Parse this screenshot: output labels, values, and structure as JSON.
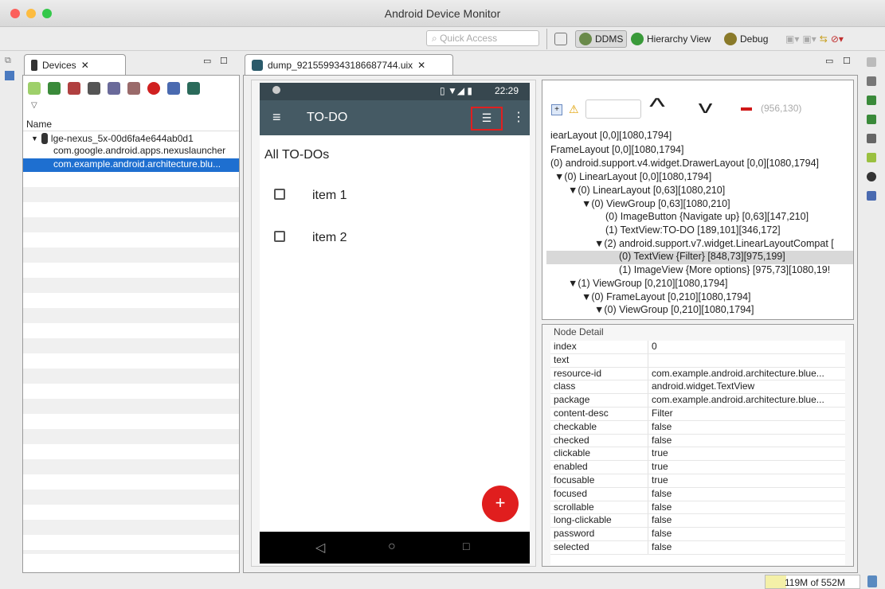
{
  "window": {
    "title": "Android Device Monitor"
  },
  "toolbar": {
    "quick_access_placeholder": "Quick Access",
    "ddms": "DDMS",
    "hierarchy_view": "Hierarchy View",
    "debug": "Debug"
  },
  "devices": {
    "tab_label": "Devices",
    "column": "Name",
    "device": "lge-nexus_5x-00d6fa4e644ab0d1",
    "processes": [
      "com.google.android.apps.nexuslauncher",
      "com.example.android.architecture.blu..."
    ]
  },
  "dump": {
    "tab_label": "dump_9215599343186687744.uix"
  },
  "phone": {
    "time": "22:29",
    "app_title": "TO-DO",
    "heading": "All TO-DOs",
    "items": [
      "item 1",
      "item 2"
    ],
    "fab": "+"
  },
  "hierarchy": {
    "coords": "(956,130)",
    "lines": [
      "iearLayout [0,0][1080,1794]",
      "FrameLayout [0,0][1080,1794]",
      "(0) android.support.v4.widget.DrawerLayout [0,0][1080,1794]",
      "(0) LinearLayout [0,0][1080,1794]",
      "(0) LinearLayout [0,63][1080,210]",
      "(0) ViewGroup [0,63][1080,210]",
      "(0) ImageButton {Navigate up} [0,63][147,210]",
      "(1) TextView:TO-DO [189,101][346,172]",
      "(2) android.support.v7.widget.LinearLayoutCompat [",
      "(0) TextView {Filter} [848,73][975,199]",
      "(1) ImageView {More options} [975,73][1080,19!",
      "(1) ViewGroup [0,210][1080,1794]",
      "(0) FrameLayout [0,210][1080,1794]",
      "(0) ViewGroup [0,210][1080,1794]"
    ]
  },
  "node_detail": {
    "title": "Node Detail",
    "rows": [
      [
        "index",
        "0"
      ],
      [
        "text",
        ""
      ],
      [
        "resource-id",
        "com.example.android.architecture.blue..."
      ],
      [
        "class",
        "android.widget.TextView"
      ],
      [
        "package",
        "com.example.android.architecture.blue..."
      ],
      [
        "content-desc",
        "Filter"
      ],
      [
        "checkable",
        "false"
      ],
      [
        "checked",
        "false"
      ],
      [
        "clickable",
        "true"
      ],
      [
        "enabled",
        "true"
      ],
      [
        "focusable",
        "true"
      ],
      [
        "focused",
        "false"
      ],
      [
        "scrollable",
        "false"
      ],
      [
        "long-clickable",
        "false"
      ],
      [
        "password",
        "false"
      ],
      [
        "selected",
        "false"
      ]
    ]
  },
  "status": {
    "memory": "119M of 552M"
  }
}
